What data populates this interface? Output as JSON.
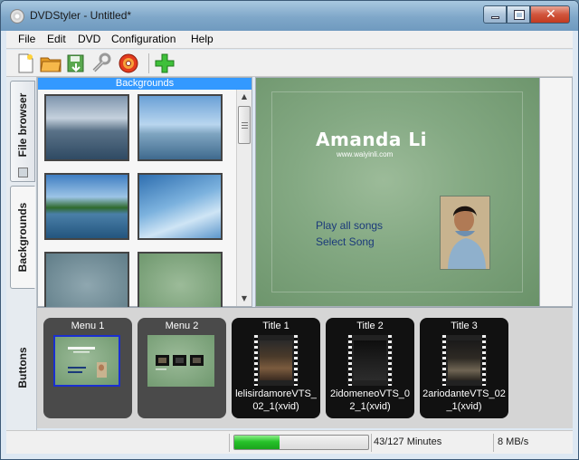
{
  "window": {
    "title": "DVDStyler - Untitled*"
  },
  "menubar": {
    "items": [
      "File",
      "Edit",
      "DVD",
      "Configuration",
      "Help"
    ]
  },
  "toolbar": {
    "icons": [
      "new-document-icon",
      "open-folder-icon",
      "save-icon",
      "settings-wrench-icon",
      "burn-dvd-icon",
      "add-plus-icon"
    ]
  },
  "side_tabs": [
    {
      "label": "File browser",
      "active": false
    },
    {
      "label": "Backgrounds",
      "active": true
    },
    {
      "label": "Buttons",
      "active": false
    }
  ],
  "backgrounds_panel": {
    "header": "Backgrounds"
  },
  "preview": {
    "title": "Amanda Li",
    "url": "www.waiyinli.com",
    "buttons": [
      "Play all songs",
      "Select Song"
    ]
  },
  "titleset": [
    {
      "label": "Menu 1",
      "kind": "menu",
      "selected": true
    },
    {
      "label": "Menu 2",
      "kind": "menu",
      "selected": false
    },
    {
      "label": "Title 1",
      "kind": "title",
      "file": "lelisirdamoreVTS_02_1(xvid)"
    },
    {
      "label": "Title 2",
      "kind": "title",
      "file": "2idomeneoVTS_02_1(xvid)"
    },
    {
      "label": "Title 3",
      "kind": "title",
      "file": "2ariodanteVTS_02_1(xvid)"
    }
  ],
  "status": {
    "progress_percent": 33.9,
    "minutes": "43/127 Minutes",
    "rate": "8 MB/s"
  },
  "colors": {
    "accent": "#3399ff",
    "progress": "#27c22a",
    "preview_bg": "#84a983"
  }
}
